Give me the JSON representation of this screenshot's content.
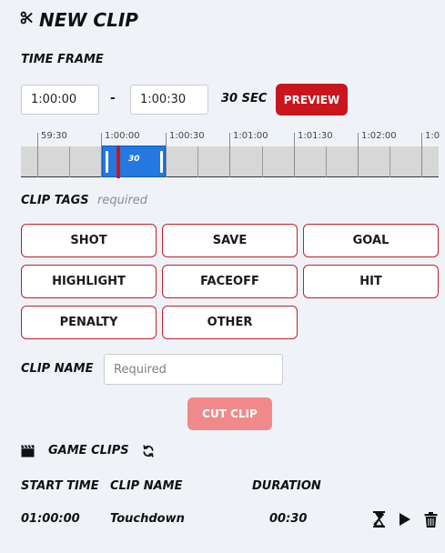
{
  "header": {
    "title": "NEW CLIP",
    "icon": "scissors-icon"
  },
  "time_frame": {
    "label": "TIME FRAME",
    "start_value": "1:00:00",
    "separator": "-",
    "end_value": "1:00:30",
    "duration_label": "30 SEC",
    "preview_label": "PREVIEW"
  },
  "timeline": {
    "tick_labels": [
      "59:30",
      "1:00:00",
      "1:00:30",
      "1:01:00",
      "1:01:30",
      "1:02:00",
      "1:0"
    ],
    "selection_label": "30"
  },
  "clip_tags": {
    "label": "CLIP TAGS",
    "hint": "required",
    "tags": [
      "SHOT",
      "SAVE",
      "GOAL",
      "HIGHLIGHT",
      "FACEOFF",
      "HIT",
      "PENALTY",
      "OTHER"
    ]
  },
  "clip_name": {
    "label": "CLIP NAME",
    "placeholder": "Required",
    "value": ""
  },
  "cut_clip": {
    "label": "CUT CLIP"
  },
  "game_clips": {
    "label": "GAME CLIPS",
    "columns": [
      "START TIME",
      "CLIP NAME",
      "DURATION"
    ],
    "rows": [
      {
        "start_time": "01:00:00",
        "clip_name": "Touchdown",
        "duration": "00:30"
      }
    ]
  },
  "colors": {
    "accent": "#c9151e",
    "selection": "#2478e0",
    "disabled_button": "#f08a8a",
    "background": "#eff3f8"
  }
}
